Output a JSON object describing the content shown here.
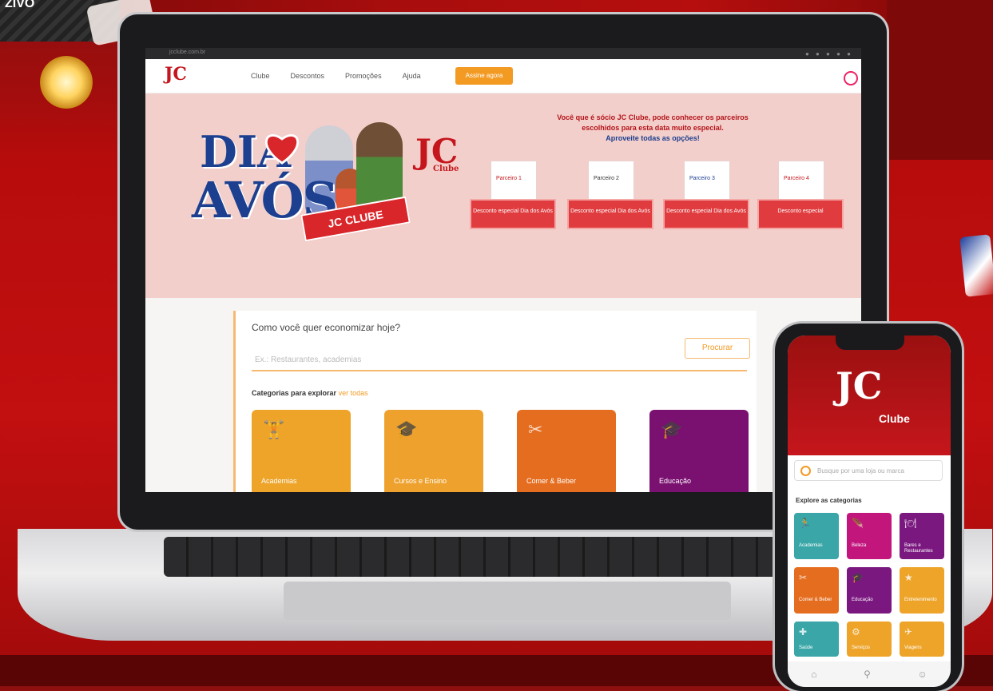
{
  "background": {
    "top_left_label": "ZIVO",
    "colors": {
      "brand_red": "#c4161c",
      "accent_orange": "#f39a23",
      "navy": "#1c3f8f"
    }
  },
  "laptop": {
    "browser_address": "jcclube.com.br",
    "site": {
      "logo": "JC",
      "nav": [
        "Clube",
        "Descontos",
        "Promoções",
        "Ajuda"
      ],
      "cta": "Assine agora",
      "hero": {
        "title_line1": "DIA",
        "title_line2": "AVÓS",
        "ribbon": "JC CLUBE",
        "brand": "JC",
        "brand_sub": "Clube",
        "text_line1": "Você que é sócio JC Clube, pode conhecer os parceiros",
        "text_line2": "escolhidos para esta data muito especial.",
        "text_link": "Aproveite todas as opções!",
        "partners": [
          {
            "name": "Parceiro 1",
            "label": "Desconto especial Dia dos Avós"
          },
          {
            "name": "Parceiro 2",
            "label": "Desconto especial Dia dos Avós"
          },
          {
            "name": "Parceiro 3",
            "label": "Desconto especial Dia dos Avós"
          },
          {
            "name": "Parceiro 4",
            "label": "Desconto especial"
          }
        ]
      },
      "search": {
        "question": "Como você quer economizar hoje?",
        "placeholder": "Ex.: Restaurantes, academias",
        "button": "Procurar"
      },
      "categories_title": "Categorias para explorar",
      "categories_more": "ver todas",
      "categories": [
        {
          "label": "Academias",
          "icon": "🏋",
          "color": "#eda429"
        },
        {
          "label": "Cursos e Ensino",
          "icon": "🎓",
          "color": "#eea12c"
        },
        {
          "label": "Comer & Beber",
          "icon": "✂",
          "color": "#e56d1f"
        },
        {
          "label": "Educação",
          "icon": "🎓",
          "color": "#7a1070"
        }
      ]
    }
  },
  "phone": {
    "logo": "JC",
    "logo_sub": "Clube",
    "search_placeholder": "Busque por uma loja ou marca",
    "categories_title": "Explore as categorias",
    "tiles": [
      {
        "label": "Academias",
        "icon": "🏃",
        "color": "#3aa6a7"
      },
      {
        "label": "Beleza",
        "icon": "🪶",
        "color": "#c2167d"
      },
      {
        "label": "Bares e Restaurantes",
        "icon": "🍽",
        "color": "#7b1880"
      },
      {
        "label": "Comer & Beber",
        "icon": "✂",
        "color": "#e56d1f"
      },
      {
        "label": "Educação",
        "icon": "🎓",
        "color": "#7b1880"
      },
      {
        "label": "Entretenimento",
        "icon": "★",
        "color": "#eda429"
      },
      {
        "label": "Saúde",
        "icon": "✚",
        "color": "#3aa6a7"
      },
      {
        "label": "Serviços",
        "icon": "⚙",
        "color": "#eda429"
      },
      {
        "label": "Viagens",
        "icon": "✈",
        "color": "#eda429"
      }
    ],
    "nav_icons": [
      "home-icon",
      "search-icon",
      "user-icon"
    ]
  }
}
